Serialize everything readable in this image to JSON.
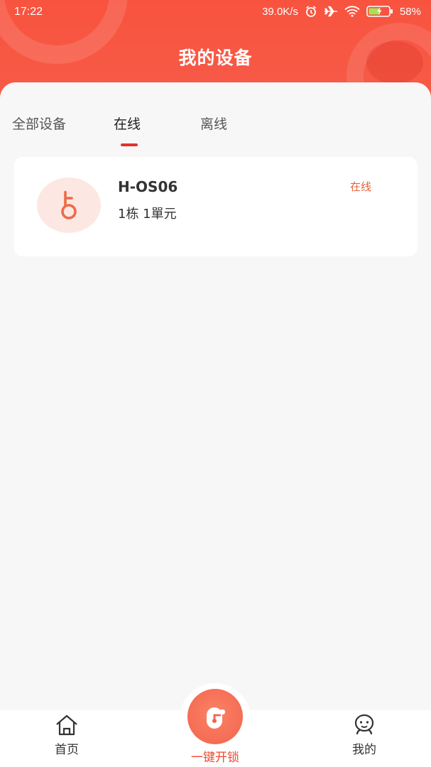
{
  "status_bar": {
    "time": "17:22",
    "net_speed": "39.0K/s",
    "battery": "58%",
    "icons": [
      "alarm-icon",
      "airplane-icon",
      "wifi-icon",
      "battery-icon"
    ]
  },
  "header": {
    "title": "我的设备"
  },
  "tabs": [
    {
      "label": "全部设备",
      "active": false
    },
    {
      "label": "在线",
      "active": true
    },
    {
      "label": "离线",
      "active": false
    }
  ],
  "devices": [
    {
      "name": "H-OS06",
      "location": "1栋 1單元",
      "status": "在线",
      "icon": "key-icon"
    }
  ],
  "bottom_nav": {
    "home": {
      "label": "首页",
      "icon": "home-icon"
    },
    "unlock": {
      "label": "一键开锁",
      "icon": "unlock-icon"
    },
    "mine": {
      "label": "我的",
      "icon": "profile-icon"
    }
  },
  "colors": {
    "header_bg": "#f8533f",
    "accent": "#e2322c",
    "status_online": "#e5623a",
    "unlock_button": "#f1644c"
  }
}
